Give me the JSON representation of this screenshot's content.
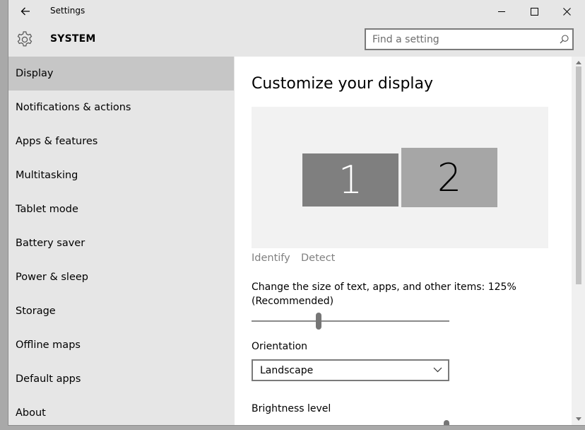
{
  "window": {
    "title": "Settings"
  },
  "header": {
    "section_title": "SYSTEM",
    "search_placeholder": "Find a setting"
  },
  "sidebar": {
    "items": [
      {
        "label": "Display",
        "selected": true
      },
      {
        "label": "Notifications & actions"
      },
      {
        "label": "Apps & features"
      },
      {
        "label": "Multitasking"
      },
      {
        "label": "Tablet mode"
      },
      {
        "label": "Battery saver"
      },
      {
        "label": "Power & sleep"
      },
      {
        "label": "Storage"
      },
      {
        "label": "Offline maps"
      },
      {
        "label": "Default apps"
      },
      {
        "label": "About"
      }
    ]
  },
  "main": {
    "title": "Customize your display",
    "monitors": [
      {
        "label": "1"
      },
      {
        "label": "2"
      }
    ],
    "identify_label": "Identify",
    "detect_label": "Detect",
    "scale_label_line1": "Change the size of text, apps, and other items: 125%",
    "scale_label_line2": "(Recommended)",
    "orientation_label": "Orientation",
    "orientation_value": "Landscape",
    "brightness_label": "Brightness level"
  },
  "icons": {
    "back": "back-arrow-icon",
    "minimize": "minimize-icon",
    "maximize": "maximize-icon",
    "close": "close-icon",
    "gear": "gear-icon",
    "search": "search-icon",
    "dropdown": "chevron-down-icon"
  },
  "colors": {
    "selected_item": "#c6c6c6",
    "monitor_1": "#7f7f7f",
    "monitor_2": "#a6a6a6"
  }
}
